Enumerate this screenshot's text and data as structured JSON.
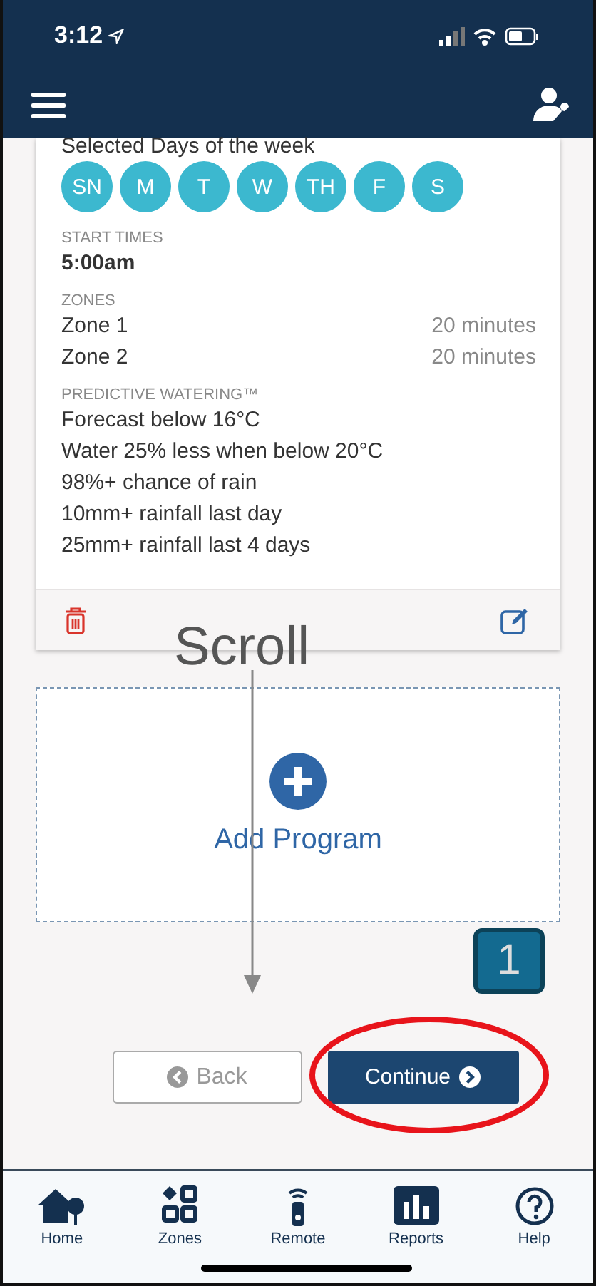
{
  "status_bar": {
    "time": "3:12"
  },
  "program": {
    "days_title": "Selected Days of the week",
    "days": [
      {
        "label": "SN",
        "selected": true
      },
      {
        "label": "M",
        "selected": true
      },
      {
        "label": "T",
        "selected": true
      },
      {
        "label": "W",
        "selected": true
      },
      {
        "label": "TH",
        "selected": true
      },
      {
        "label": "F",
        "selected": true
      },
      {
        "label": "S",
        "selected": true
      }
    ],
    "start_times_label": "START TIMES",
    "start_time": "5:00am",
    "zones_label": "ZONES",
    "zones": [
      {
        "name": "Zone 1",
        "duration": "20 minutes"
      },
      {
        "name": "Zone 2",
        "duration": "20 minutes"
      }
    ],
    "predictive_label": "PREDICTIVE WATERING™",
    "predictive": [
      "Forecast below 16°C",
      "Water 25% less when below 20°C",
      "98%+ chance of rain",
      "10mm+ rainfall last day",
      "25mm+ rainfall last 4 days"
    ]
  },
  "add_program": "Add Program",
  "annotation": {
    "scroll": "Scroll",
    "step": "1"
  },
  "buttons": {
    "back": "Back",
    "continue": "Continue"
  },
  "tab_bar": [
    {
      "label": "Home",
      "kind": "home"
    },
    {
      "label": "Zones",
      "kind": "zones"
    },
    {
      "label": "Remote",
      "kind": "remote"
    },
    {
      "label": "Reports",
      "kind": "reports"
    },
    {
      "label": "Help",
      "kind": "help"
    }
  ]
}
